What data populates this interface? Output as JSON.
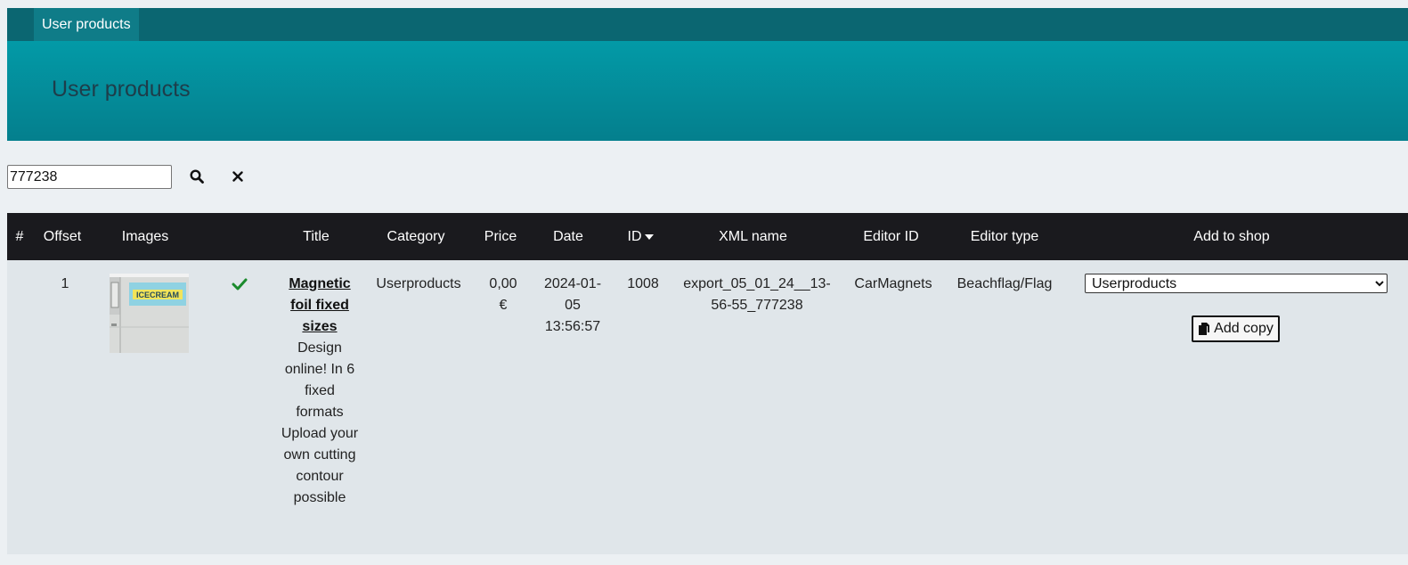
{
  "nav": {
    "tab_label": "User products"
  },
  "page": {
    "title": "User products"
  },
  "search": {
    "value": "777238",
    "search_icon": "search-icon",
    "clear_icon": "close-icon"
  },
  "table": {
    "headers": {
      "num": "#",
      "offset": "Offset",
      "images": "Images",
      "title": "Title",
      "category": "Category",
      "price": "Price",
      "date": "Date",
      "id": "ID",
      "xml_name": "XML name",
      "editor_id": "Editor ID",
      "editor_type": "Editor type",
      "add_to_shop": "Add to shop"
    },
    "sort": {
      "column": "ID",
      "direction": "descending"
    },
    "rows": [
      {
        "num": "1",
        "image_text": "ICECREAM",
        "status_icon": "checkmark-icon",
        "status_color": "#1a8a2c",
        "title": "Magnetic foil fixed sizes",
        "description": "Design online! In 6 fixed formats Upload your own cutting contour possible",
        "category": "Userproducts",
        "price": "0,00 €",
        "date": "2024-01-05 13:56:57",
        "id": "1008",
        "xml_name": "export_05_01_24__13-56-55_777238",
        "editor_id": "CarMagnets",
        "editor_type": "Beachflag/Flag",
        "shop_selected": "Userproducts",
        "add_copy_label": "Add copy",
        "add_copy_icon": "copy-icon"
      }
    ]
  },
  "colors": {
    "topbar": "#0b6671",
    "hero_top": "#039aa7",
    "hero_bottom": "#047f8d",
    "table_header": "#1a1a1e",
    "row_bg": "#e0e6ea",
    "page_bg": "#ecf0f3"
  }
}
